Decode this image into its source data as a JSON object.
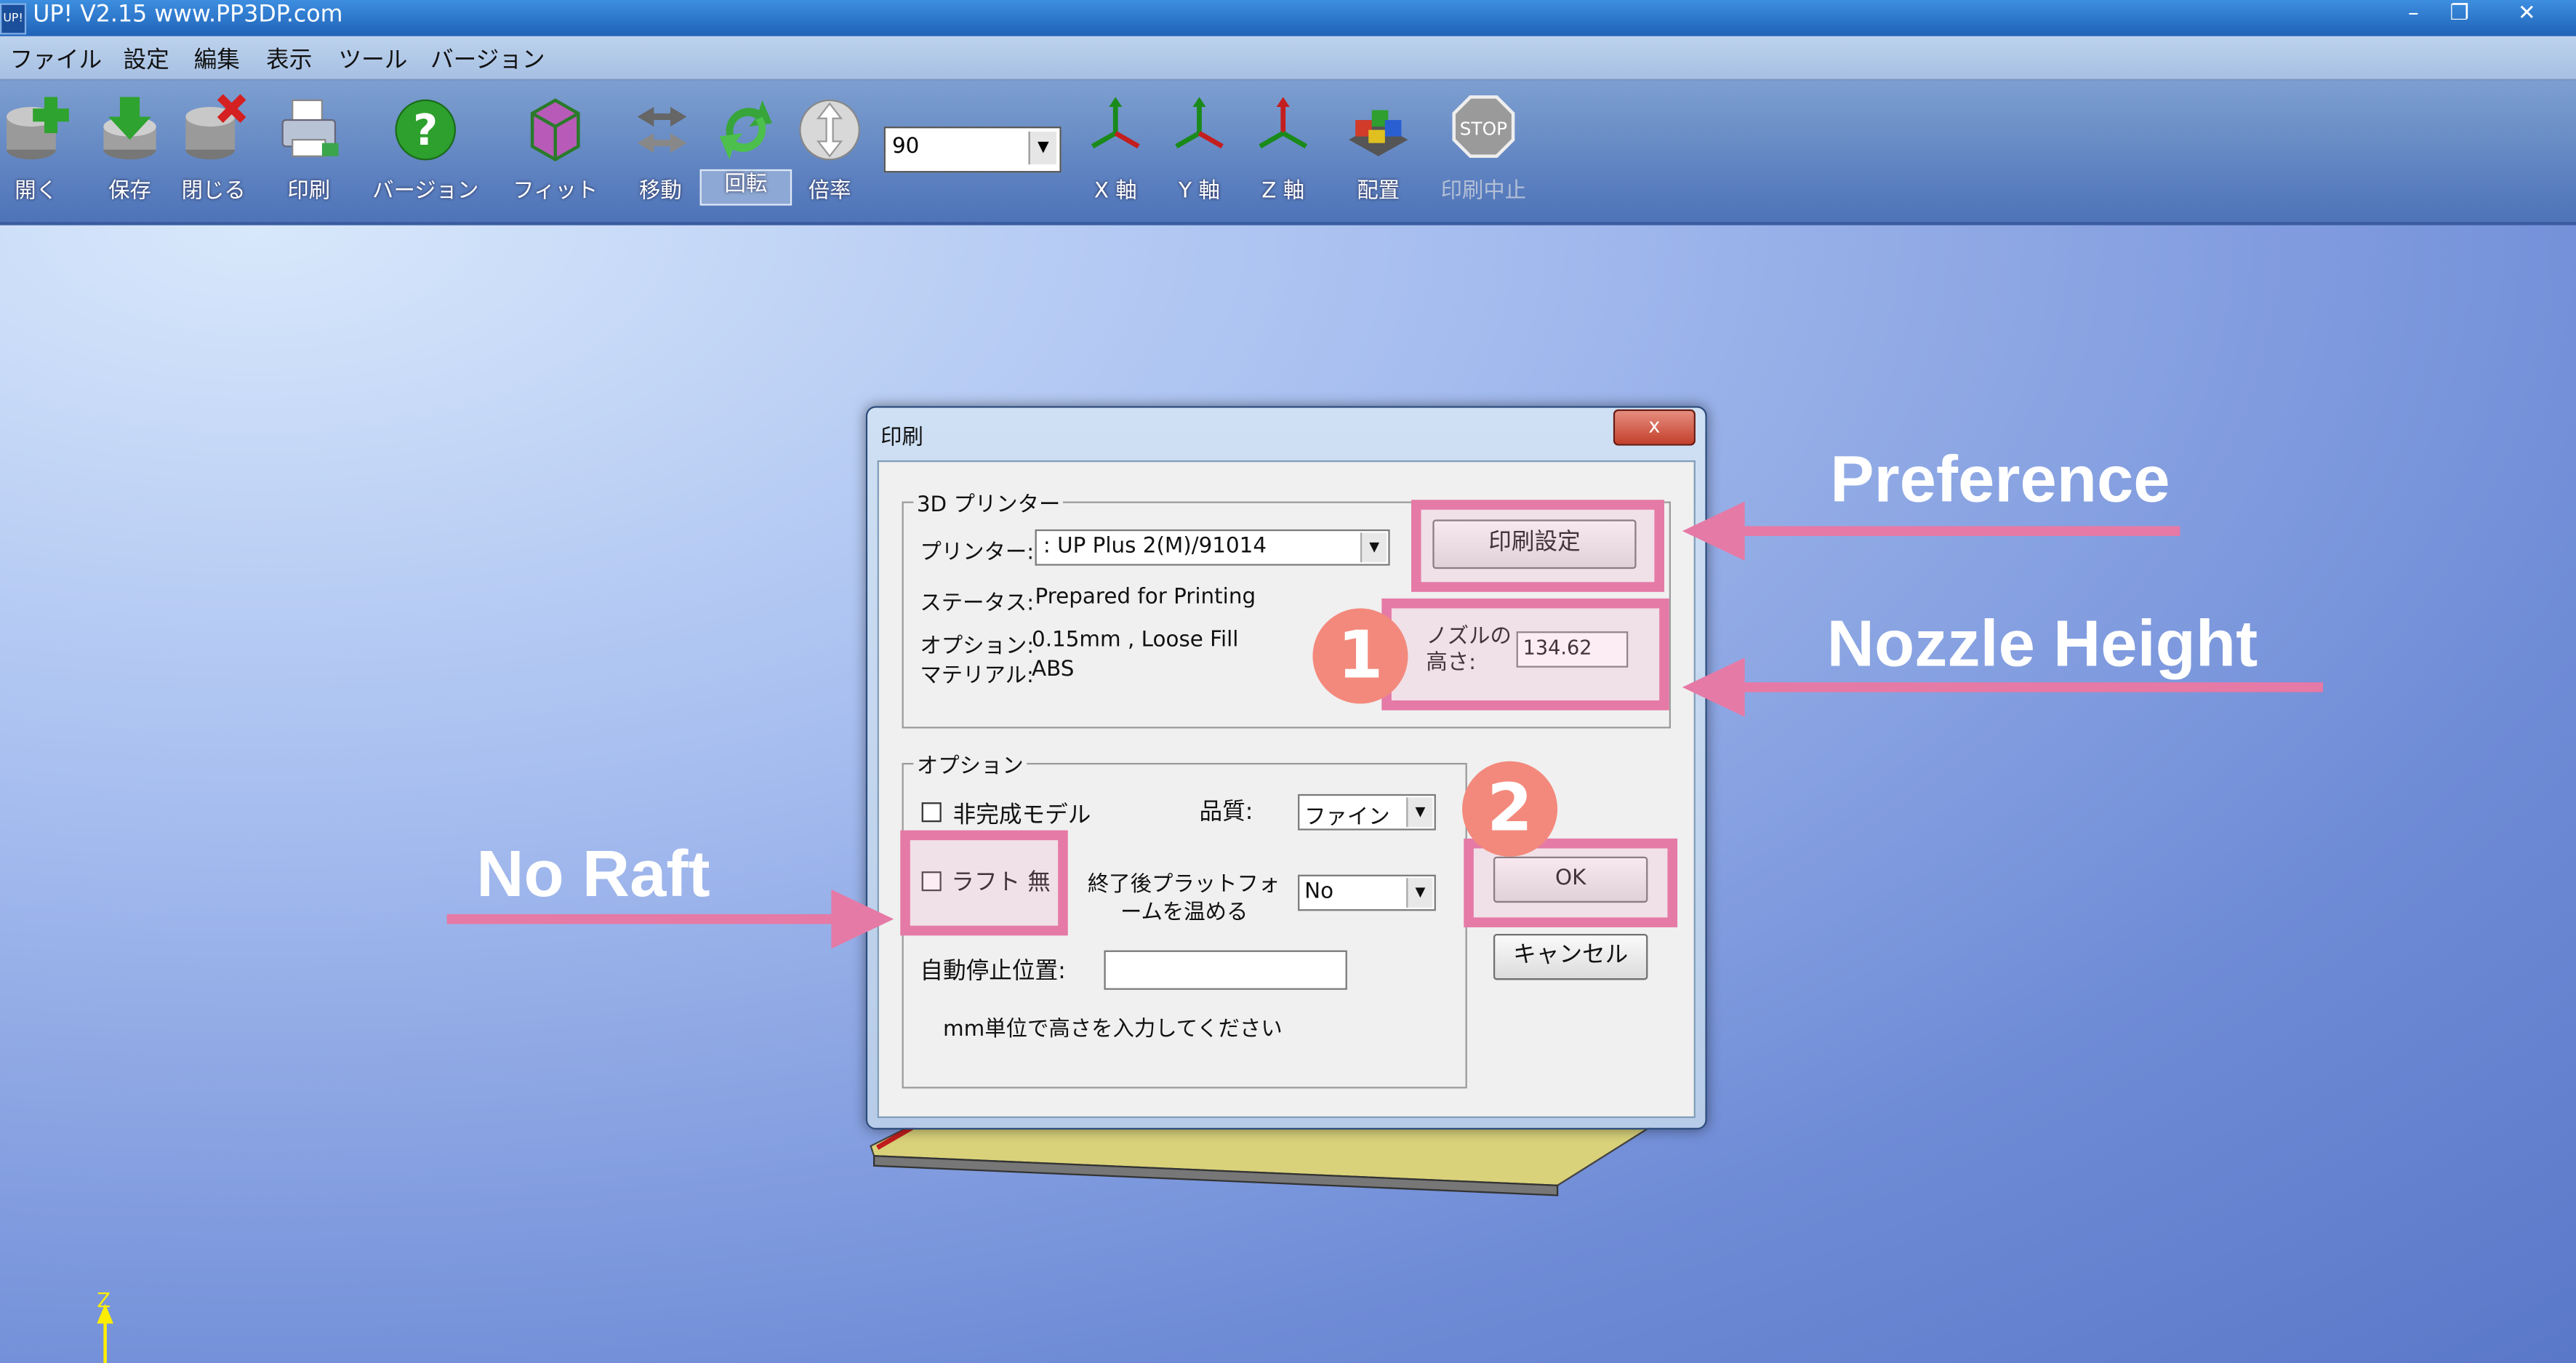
{
  "window": {
    "title": "UP!  V2.15 www.PP3DP.com",
    "controls": [
      "–",
      "❐",
      "✕"
    ]
  },
  "menu": [
    "ファイル",
    "設定",
    "編集",
    "表示",
    "ツール",
    "バージョン"
  ],
  "toolbar": {
    "buttons": [
      "開く",
      "保存",
      "閉じる",
      "印刷",
      "バージョン",
      "フィット",
      "移動",
      "回転",
      "倍率",
      "X 軸",
      "Y 軸",
      "Z 軸",
      "配置",
      "印刷中止"
    ],
    "stop_icon_text": "STOP",
    "angle_value": "90"
  },
  "axis_label": "Z",
  "dialog": {
    "title": "印刷",
    "close": "x",
    "printer_group": {
      "title": "3D プリンター",
      "printer_label": "プリンター:",
      "printer_value": ": UP Plus 2(M)/91014",
      "status_label": "ステータス:",
      "status_value": "Prepared for Printing",
      "options_label": "オプション:",
      "options_value": "0.15mm , Loose Fill",
      "material_label": "マテリアル:",
      "material_value": "ABS",
      "preference_button": "印刷設定",
      "nozzle_label_1": "ノズルの",
      "nozzle_label_2": "高さ:",
      "nozzle_value": "134.62"
    },
    "options_group": {
      "title": "オプション",
      "incomplete_model": "非完成モデル",
      "quality_label": "品質:",
      "quality_value": "ファイン",
      "no_raft": "ラフト 無",
      "heat_label_1": "終了後プラットフォ",
      "heat_label_2": "ームを温める",
      "heat_value": "No",
      "auto_stop_label": "自動停止位置:",
      "auto_stop_value": "",
      "hint": "mm単位で高さを入力してください"
    },
    "ok": "OK",
    "cancel": "キャンセル"
  },
  "annotations": {
    "preference": "Preference",
    "nozzle_height": "Nozzle Height",
    "no_raft": "No Raft",
    "step1": "1",
    "step2": "2",
    "color": "#e57aa6",
    "badge_color": "#f3897c"
  }
}
